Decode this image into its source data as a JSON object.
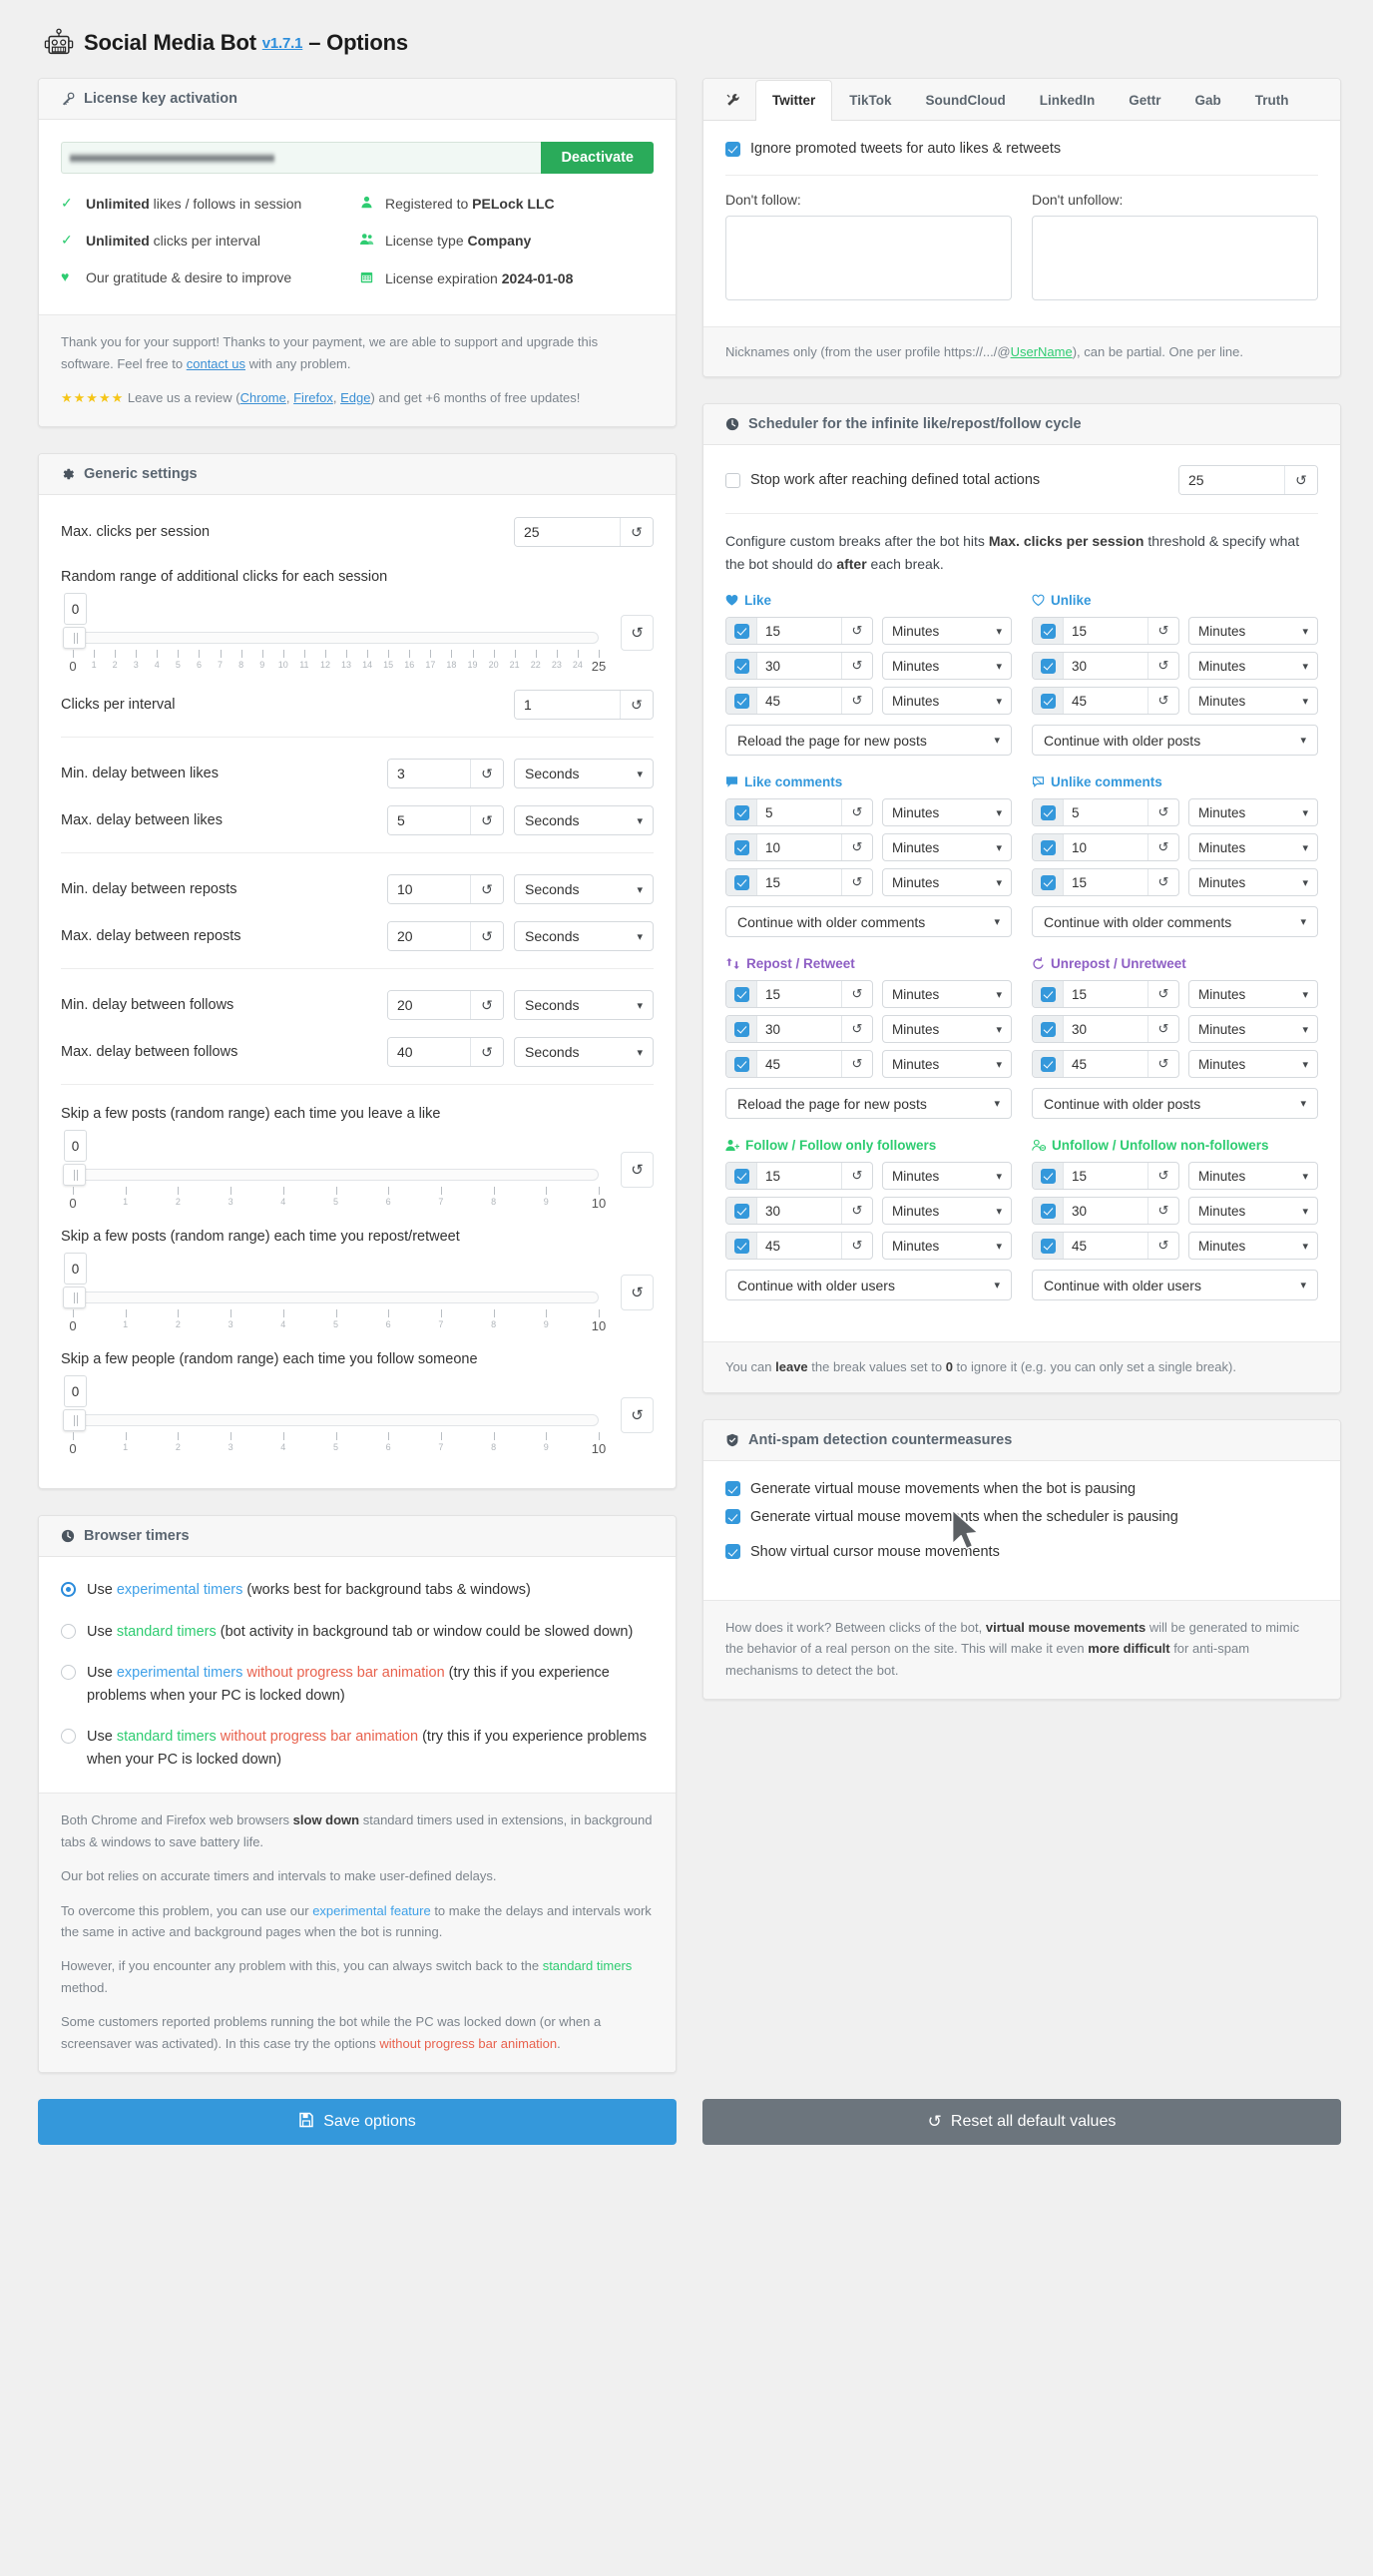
{
  "header": {
    "title": "Social Media Bot",
    "version": "v1.7.1",
    "suffix": "– Options",
    "icon": "robot-icon"
  },
  "license": {
    "panel_title": "License key activation",
    "panel_icon": "key-icon",
    "key_value": "",
    "key_placeholder": "",
    "deactivate_label": "Deactivate",
    "features_left": [
      {
        "icon": "check-icon",
        "strong": "Unlimited",
        "text": " likes / follows in session"
      },
      {
        "icon": "check-icon",
        "strong": "Unlimited",
        "text": " clicks per interval"
      },
      {
        "icon": "heart-icon",
        "strong": "",
        "text": "Our gratitude & desire to improve",
        "html": true
      }
    ],
    "features_right": [
      {
        "icon": "user-icon",
        "pre": "Registered to ",
        "strong": "PELock LLC"
      },
      {
        "icon": "users-icon",
        "pre": "License type ",
        "strong": "Company"
      },
      {
        "icon": "calendar-icon",
        "pre": "License expiration ",
        "strong": "2024-01-08"
      }
    ],
    "footer_line1": "Thank you for your support! Thanks to your payment, we are able to support and upgrade this software. Feel free to ",
    "footer_contact": "contact us",
    "footer_line1_end": " with any problem.",
    "stars": "★★★★★",
    "footer_line2_pre": " Leave us a review (",
    "review_links": [
      "Chrome",
      "Firefox",
      "Edge"
    ],
    "footer_line2_post": ") and get +6 months of free updates!"
  },
  "generic": {
    "panel_title": "Generic settings",
    "panel_icon": "gear-icon",
    "max_clicks_label": "Max. clicks per session",
    "max_clicks_value": "25",
    "random_range_label": "Random range of additional clicks for each session",
    "random_range_value": "0",
    "random_range_min": "0",
    "random_range_max": "25",
    "clicks_per_interval_label": "Clicks per interval",
    "clicks_per_interval_value": "1",
    "rows": [
      {
        "label": "Min. delay between likes",
        "value": "3",
        "unit": "Seconds"
      },
      {
        "label": "Max. delay between likes",
        "value": "5",
        "unit": "Seconds"
      },
      {
        "label": "Min. delay between reposts",
        "value": "10",
        "unit": "Seconds"
      },
      {
        "label": "Max. delay between reposts",
        "value": "20",
        "unit": "Seconds"
      },
      {
        "label": "Min. delay between follows",
        "value": "20",
        "unit": "Seconds"
      },
      {
        "label": "Max. delay between follows",
        "value": "40",
        "unit": "Seconds"
      }
    ],
    "skip_sliders": [
      {
        "label": "Skip a few posts (random range) each time you leave a like",
        "value": "0",
        "min": "0",
        "max": "10"
      },
      {
        "label": "Skip a few posts (random range) each time you repost/retweet",
        "value": "0",
        "min": "0",
        "max": "10"
      },
      {
        "label": "Skip a few people (random range) each time you follow someone",
        "value": "0",
        "min": "0",
        "max": "10"
      }
    ],
    "reset_icon": "reset-icon"
  },
  "browser_timers": {
    "panel_title": "Browser timers",
    "panel_icon": "clock-icon",
    "options": [
      {
        "selected": true,
        "pre": "Use ",
        "hl": "experimental timers",
        "hl_color": "blue",
        "post": " (works best for background tabs & windows)"
      },
      {
        "selected": false,
        "pre": "Use ",
        "hl": "standard timers",
        "hl_color": "green",
        "post": " (bot activity in background tab or window could be slowed down)"
      },
      {
        "selected": false,
        "pre": "Use ",
        "hl": "experimental timers",
        "hl_color": "blue",
        "hl2": " without progress bar animation",
        "hl2_color": "red",
        "post": " (try this if you experience problems when your PC is locked down)"
      },
      {
        "selected": false,
        "pre": "Use ",
        "hl": "standard timers",
        "hl_color": "green",
        "hl2": " without progress bar animation",
        "hl2_color": "red",
        "post": " (try this if you experience problems when your PC is locked down)"
      }
    ],
    "foot_p1_a": "Both Chrome and Firefox web browsers ",
    "foot_p1_b": "slow down",
    "foot_p1_c": " standard timers used in extensions, in background tabs & windows to save battery life.",
    "foot_p2": "Our bot relies on accurate timers and intervals to make user-defined delays.",
    "foot_p3_a": "To overcome this problem, you can use our ",
    "foot_p3_b": "experimental feature",
    "foot_p3_c": " to make the delays and intervals work the same in active and background pages when the bot is running.",
    "foot_p4_a": "However, if you encounter any problem with this, you can always switch back to the ",
    "foot_p4_b": "standard timers",
    "foot_p4_c": " method.",
    "foot_p5_a": "Some customers reported problems running the bot while the PC was locked down (or when a screensaver was activated). In this case try the options ",
    "foot_p5_b": "without progress bar animation",
    "foot_p5_c": "."
  },
  "platform": {
    "tools_tab_icon": "tools-icon",
    "tabs": [
      {
        "label": "Twitter",
        "active": true
      },
      {
        "label": "TikTok",
        "active": false
      },
      {
        "label": "SoundCloud",
        "active": false
      },
      {
        "label": "LinkedIn",
        "active": false
      },
      {
        "label": "Gettr",
        "active": false
      },
      {
        "label": "Gab",
        "active": false
      },
      {
        "label": "Truth",
        "active": false
      }
    ],
    "ignore_promoted_label": "Ignore promoted tweets for auto likes & retweets",
    "ignore_promoted_checked": true,
    "dont_follow_label": "Don't follow:",
    "dont_follow_value": "",
    "dont_unfollow_label": "Don't unfollow:",
    "dont_unfollow_value": "",
    "foot_a": "Nicknames only (from the user profile https://.../@",
    "foot_link": "UserName",
    "foot_b": "), can be partial. One per line."
  },
  "scheduler": {
    "panel_title": "Scheduler for the infinite like/repost/follow cycle",
    "panel_icon": "clock-icon",
    "stop_work_label": "Stop work after reaching defined total actions",
    "stop_work_checked": false,
    "stop_work_value": "25",
    "note_a": "Configure custom breaks after the bot hits ",
    "note_b": "Max. clicks per session",
    "note_c": " threshold & specify what the bot should do ",
    "note_d": "after",
    "note_e": " each break.",
    "groups": [
      {
        "title": "Like",
        "icon": "heart-filled-icon",
        "color": "like",
        "breaks": [
          {
            "checked": true,
            "value": "15",
            "unit": "Minutes"
          },
          {
            "checked": true,
            "value": "30",
            "unit": "Minutes"
          },
          {
            "checked": true,
            "value": "45",
            "unit": "Minutes"
          }
        ],
        "action": "Reload the page for new posts"
      },
      {
        "title": "Unlike",
        "icon": "heart-outline-icon",
        "color": "like",
        "breaks": [
          {
            "checked": true,
            "value": "15",
            "unit": "Minutes"
          },
          {
            "checked": true,
            "value": "30",
            "unit": "Minutes"
          },
          {
            "checked": true,
            "value": "45",
            "unit": "Minutes"
          }
        ],
        "action": "Continue with older posts"
      },
      {
        "title": "Like comments",
        "icon": "comment-filled-icon",
        "color": "like",
        "breaks": [
          {
            "checked": true,
            "value": "5",
            "unit": "Minutes"
          },
          {
            "checked": true,
            "value": "10",
            "unit": "Minutes"
          },
          {
            "checked": true,
            "value": "15",
            "unit": "Minutes"
          }
        ],
        "action": "Continue with older comments"
      },
      {
        "title": "Unlike comments",
        "icon": "comment-outline-icon",
        "color": "like",
        "breaks": [
          {
            "checked": true,
            "value": "5",
            "unit": "Minutes"
          },
          {
            "checked": true,
            "value": "10",
            "unit": "Minutes"
          },
          {
            "checked": true,
            "value": "15",
            "unit": "Minutes"
          }
        ],
        "action": "Continue with older comments"
      },
      {
        "title": "Repost / Retweet",
        "icon": "retweet-icon",
        "color": "repost",
        "breaks": [
          {
            "checked": true,
            "value": "15",
            "unit": "Minutes"
          },
          {
            "checked": true,
            "value": "30",
            "unit": "Minutes"
          },
          {
            "checked": true,
            "value": "45",
            "unit": "Minutes"
          }
        ],
        "action": "Reload the page for new posts"
      },
      {
        "title": "Unrepost / Unretweet",
        "icon": "undo-icon",
        "color": "repost",
        "breaks": [
          {
            "checked": true,
            "value": "15",
            "unit": "Minutes"
          },
          {
            "checked": true,
            "value": "30",
            "unit": "Minutes"
          },
          {
            "checked": true,
            "value": "45",
            "unit": "Minutes"
          }
        ],
        "action": "Continue with older posts"
      },
      {
        "title": "Follow / Follow only followers",
        "icon": "user-plus-icon",
        "color": "follow",
        "breaks": [
          {
            "checked": true,
            "value": "15",
            "unit": "Minutes"
          },
          {
            "checked": true,
            "value": "30",
            "unit": "Minutes"
          },
          {
            "checked": true,
            "value": "45",
            "unit": "Minutes"
          }
        ],
        "action": "Continue with older users"
      },
      {
        "title": "Unfollow / Unfollow non-followers",
        "icon": "user-minus-icon",
        "color": "follow",
        "breaks": [
          {
            "checked": true,
            "value": "15",
            "unit": "Minutes"
          },
          {
            "checked": true,
            "value": "30",
            "unit": "Minutes"
          },
          {
            "checked": true,
            "value": "45",
            "unit": "Minutes"
          }
        ],
        "action": "Continue with older users"
      }
    ],
    "foot_a": "You can ",
    "foot_b": "leave",
    "foot_c": " the break values set to ",
    "foot_d": "0",
    "foot_e": " to ignore it (e.g. you can only set a single break)."
  },
  "antispam": {
    "panel_title": "Anti-spam detection countermeasures",
    "panel_icon": "shield-icon",
    "options": [
      {
        "label": "Generate virtual mouse movements when the bot is pausing",
        "checked": true
      },
      {
        "label": "Generate virtual mouse movements when the scheduler is pausing",
        "checked": true
      },
      {
        "label": "Show virtual cursor mouse movements",
        "checked": true
      }
    ],
    "foot_a": "How does it work? Between clicks of the bot, ",
    "foot_b": "virtual mouse movements",
    "foot_c": " will be generated to mimic the behavior of a real person on the site. This will make it even ",
    "foot_d": "more difficult",
    "foot_e": " for anti-spam mechanisms to detect the bot."
  },
  "footer_buttons": {
    "save_label": "Save options",
    "save_icon": "save-icon",
    "reset_label": "Reset all default values",
    "reset_icon": "reset-icon"
  }
}
